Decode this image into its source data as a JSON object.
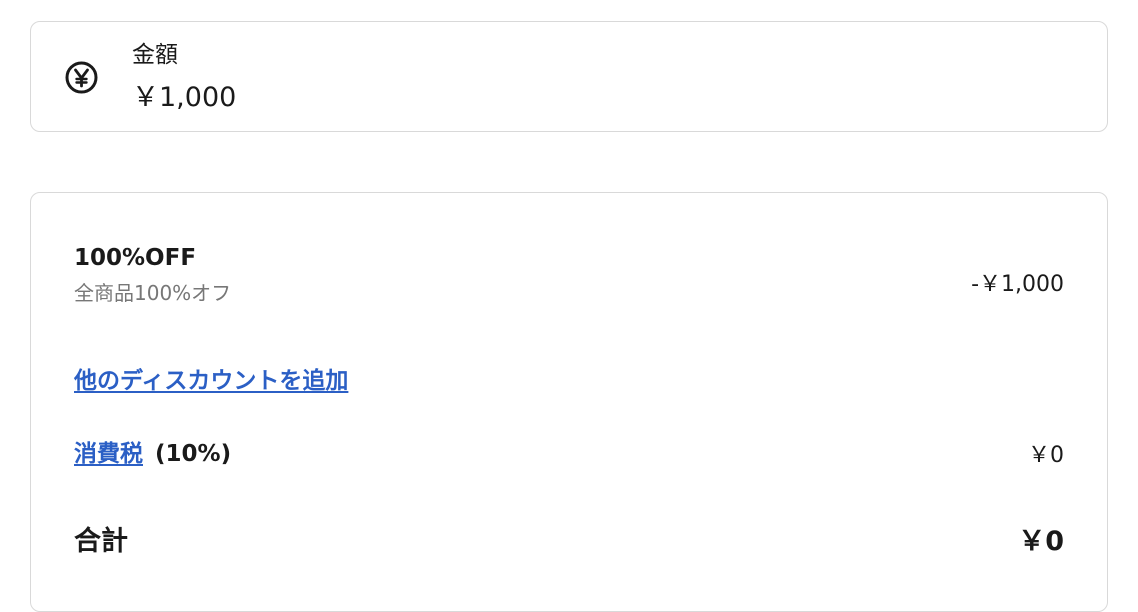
{
  "amount": {
    "label": "金額",
    "value": "￥1,000",
    "icon": "yen-icon"
  },
  "discount": {
    "title": "100%OFF",
    "description": "全商品100%オフ",
    "amount": "-￥1,000"
  },
  "add_discount_link": "他のディスカウントを追加",
  "tax": {
    "label": "消費税",
    "rate": "(10%)",
    "amount": "￥0"
  },
  "total": {
    "label": "合計",
    "amount": "￥0"
  },
  "colors": {
    "link": "#2b5fc5",
    "border": "#d9d9d9",
    "muted_text": "#777777"
  }
}
